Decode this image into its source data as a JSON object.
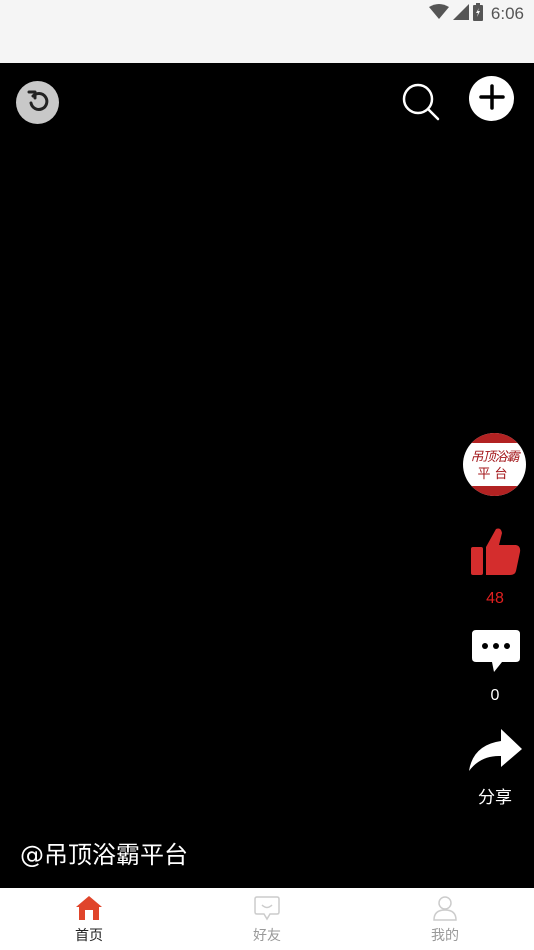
{
  "status_bar": {
    "time": "6:06",
    "icons": [
      "wifi-icon",
      "signal-icon",
      "battery-icon"
    ]
  },
  "top_bar": {
    "left_icon": "refresh-icon",
    "right_icons": [
      "search-icon",
      "add-icon"
    ]
  },
  "side_actions": {
    "avatar": {
      "logo_text_line1": "吊顶浴霸",
      "logo_text_line2": "平台"
    },
    "like": {
      "icon": "thumbs-up-icon",
      "count": "48",
      "color": "#e02020"
    },
    "comment": {
      "icon": "comment-icon",
      "count": "0"
    },
    "share": {
      "icon": "share-icon",
      "label": "分享"
    }
  },
  "video": {
    "author": "@吊顶浴霸平台"
  },
  "bottom_nav": {
    "items": [
      {
        "label": "首页",
        "icon": "home-icon",
        "active": true
      },
      {
        "label": "好友",
        "icon": "message-icon",
        "active": false
      },
      {
        "label": "我的",
        "icon": "user-icon",
        "active": false
      }
    ],
    "active_color": "#e0452b",
    "inactive_color": "#cccccc"
  }
}
